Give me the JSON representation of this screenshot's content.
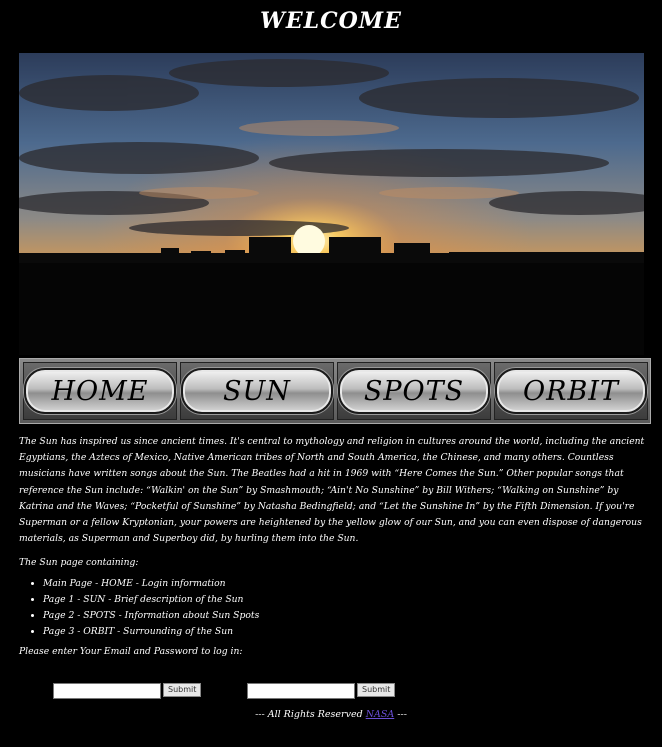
{
  "header": {
    "title": "WELCOME"
  },
  "nav": {
    "items": [
      {
        "label": "HOME"
      },
      {
        "label": "SUN"
      },
      {
        "label": "SPOTS"
      },
      {
        "label": "ORBIT"
      }
    ]
  },
  "content": {
    "intro": "The Sun has inspired us since ancient times. It's central to mythology and religion in cultures around the world, including the ancient Egyptians, the Aztecs of Mexico, Native American tribes of North and South America, the Chinese, and many others. Countless musicians have written songs about the Sun. The Beatles had a hit in 1969 with “Here Comes the Sun.” Other popular songs that reference the Sun include: “Walkin' on the Sun” by Smashmouth; “Ain't No Sunshine” by Bill Withers; “Walking on Sunshine” by Katrina and the Waves; “Pocketful of Sunshine” by Natasha Bedingfield; and “Let the Sunshine In” by the Fifth Dimension. If you're Superman or a fellow Kryptonian, your powers are heightened by the yellow glow of our Sun, and you can even dispose of dangerous materials, as Superman and Superboy did, by hurling them into the Sun.",
    "list_heading": "The Sun page containing:",
    "list": [
      "Main Page - HOME - Login information",
      "Page 1 - SUN - Brief description of the Sun",
      "Page 2 - SPOTS - Information about Sun Spots",
      "Page 3 - ORBIT - Surrounding of the Sun"
    ],
    "login_label": "Please enter Your Email and Password to log in:"
  },
  "form": {
    "email_value": "",
    "password_value": "",
    "submit_label_1": "Submit",
    "submit_label_2": "Submit"
  },
  "footer": {
    "text": "--- All Rights Reserved",
    "link": "NASA",
    "tail": "---"
  }
}
